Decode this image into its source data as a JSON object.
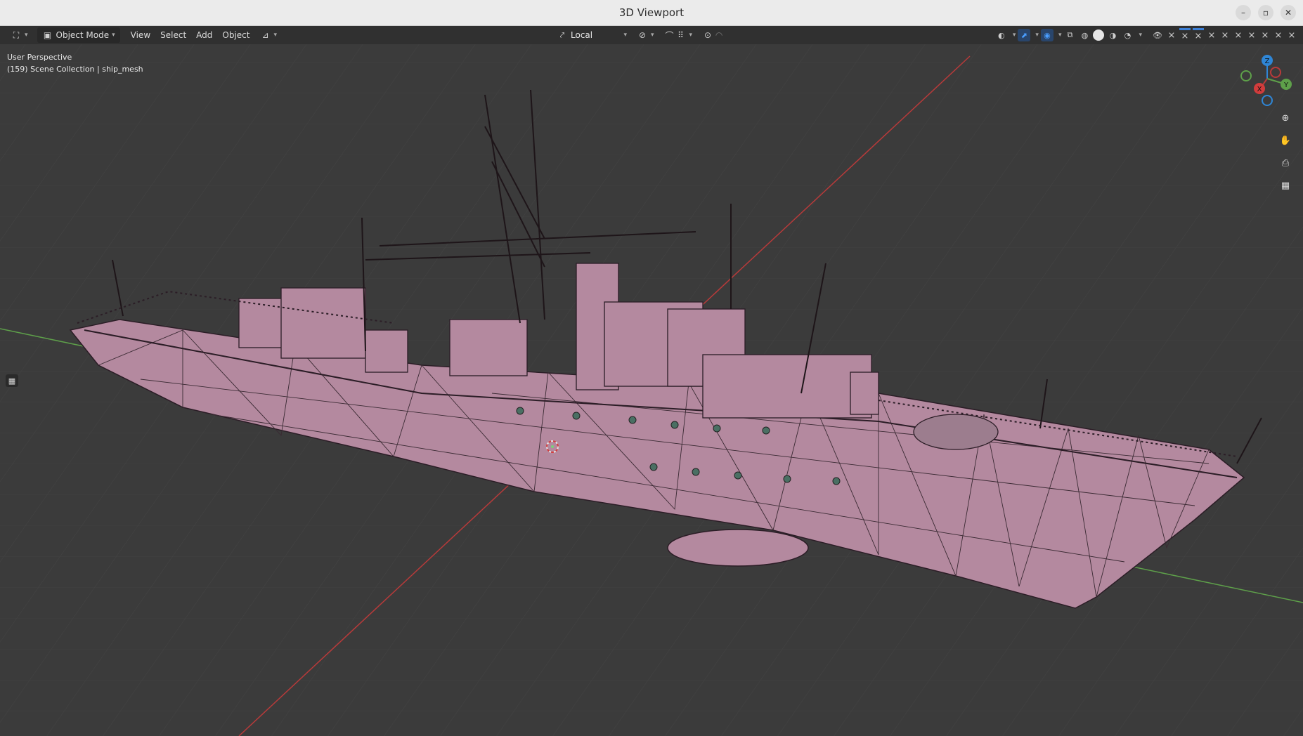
{
  "window": {
    "title": "3D Viewport",
    "buttons": [
      "–",
      "▫",
      "✕"
    ]
  },
  "header": {
    "mode_label": "Object Mode",
    "menus": [
      "View",
      "Select",
      "Add",
      "Object"
    ],
    "transform_orientation": "Local"
  },
  "overlay": {
    "perspective": "User Perspective",
    "collection": "(159) Scene Collection | ship_mesh"
  },
  "gizmo": {
    "z": "Z",
    "y": "Y",
    "x": "X"
  },
  "icons": {
    "editor_type": "editor-type-icon",
    "object_mode": "object-mode-icon",
    "snap": "snap-icon",
    "proportional": "proportional-edit-icon",
    "visibility": "visibility-icon",
    "gizmo_toggle": "gizmo-toggle-icon",
    "overlay_toggle": "overlay-toggle-icon",
    "xray": "xray-icon",
    "zoom": "zoom-icon",
    "pan": "hand-icon",
    "camera": "camera-icon",
    "grid": "grid-icon"
  },
  "colors": {
    "viewport_bg": "#3b3b3b",
    "mesh": "#b4899f",
    "x_axis": "#b83a3a",
    "y_axis": "#5ea04a",
    "z_gizmo": "#2f86d6"
  }
}
